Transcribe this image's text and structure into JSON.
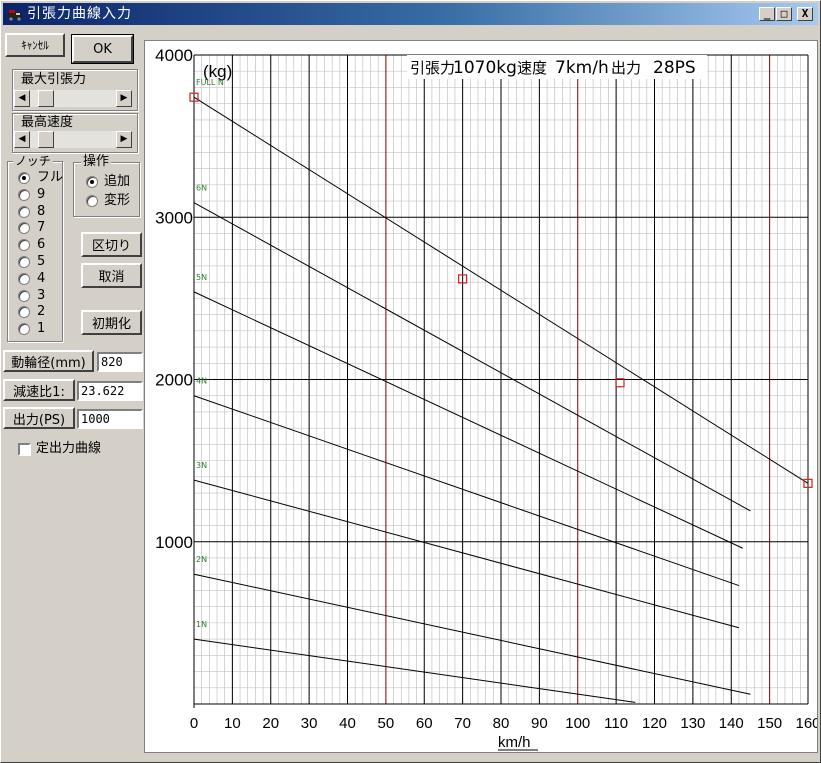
{
  "window": {
    "title": "引張力曲線入力",
    "min_btn": "_",
    "max_btn": "□",
    "close_btn": "X"
  },
  "buttons": {
    "cancel": "ｷｬﾝｾﾙ",
    "ok": "OK",
    "section": "区切り",
    "undo": "取消",
    "initialize": "初期化",
    "wheel_diameter": "動輪径(mm)",
    "reduction_ratio": "減速比1:",
    "output": "出力(PS)"
  },
  "sliders": [
    {
      "label": "最大引張力",
      "level": 0.12
    },
    {
      "label": "最高速度",
      "level": 0.12
    }
  ],
  "notch": {
    "label": "ノッチ",
    "options": [
      "フル",
      "9",
      "8",
      "7",
      "6",
      "5",
      "4",
      "3",
      "2",
      "1"
    ],
    "selected": 0
  },
  "operation": {
    "label": "操作",
    "options": [
      "追加",
      "変形"
    ],
    "selected": 0
  },
  "fields": {
    "wheel_diameter": "820",
    "reduction_ratio": "23.622",
    "output": "1000"
  },
  "constant_output_curve": {
    "label": "定出力曲線",
    "checked": false
  },
  "status": {
    "tension_label": "引張力",
    "tension_value": "1070kg",
    "speed_label": "速度",
    "speed_value": "7km/h",
    "power_label": "出力",
    "power_value": "28PS"
  },
  "colors": {
    "accent": "#8b0000",
    "point": "#cc2222",
    "notch_label": "#2e7d32"
  },
  "chart_data": {
    "type": "line",
    "xlabel": "km/h",
    "ylabel": "(kg)",
    "xlim": [
      0,
      160
    ],
    "ylim": [
      0,
      4000
    ],
    "x_ticks": [
      0,
      10,
      20,
      30,
      40,
      50,
      60,
      70,
      80,
      90,
      100,
      110,
      120,
      130,
      140,
      150,
      160
    ],
    "y_ticks": [
      1000,
      2000,
      3000,
      4000
    ],
    "series": [
      {
        "name": "FULL N",
        "x": [
          0,
          160
        ],
        "y": [
          3740,
          1360
        ]
      },
      {
        "name": "6N",
        "x": [
          0,
          145
        ],
        "y": [
          3090,
          1190
        ]
      },
      {
        "name": "5N",
        "x": [
          0,
          143
        ],
        "y": [
          2540,
          960
        ]
      },
      {
        "name": "4N",
        "x": [
          0,
          142
        ],
        "y": [
          1900,
          730
        ]
      },
      {
        "name": "3N",
        "x": [
          0,
          142
        ],
        "y": [
          1380,
          470
        ]
      },
      {
        "name": "2N",
        "x": [
          0,
          145
        ],
        "y": [
          800,
          60
        ]
      },
      {
        "name": "1N",
        "x": [
          0,
          115
        ],
        "y": [
          400,
          10
        ]
      }
    ],
    "points": [
      {
        "x": 0,
        "y": 3740
      },
      {
        "x": 70,
        "y": 2620
      },
      {
        "x": 111,
        "y": 1980
      },
      {
        "x": 160,
        "y": 1360
      }
    ]
  }
}
